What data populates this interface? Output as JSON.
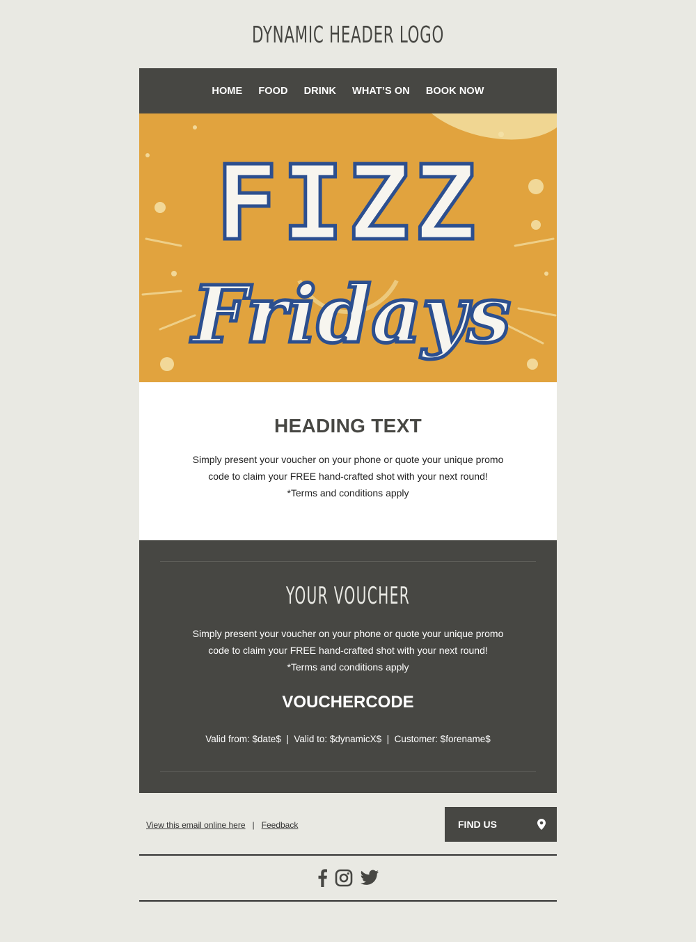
{
  "header": {
    "logo_text": "DYNAMIC HEADER LOGO"
  },
  "nav": {
    "items": [
      {
        "label": "HOME"
      },
      {
        "label": "FOOD"
      },
      {
        "label": "DRINK"
      },
      {
        "label": "WHAT’S ON"
      },
      {
        "label": "BOOK NOW"
      }
    ]
  },
  "hero": {
    "line1": "FIZZ",
    "line2": "Fridays",
    "bg_color": "#e1a33e"
  },
  "intro": {
    "heading": "HEADING TEXT",
    "line1": "Simply present your voucher on your phone or quote your unique promo",
    "line2": "code to claim your FREE hand-crafted shot with your next round!",
    "line3": "*Terms and conditions apply"
  },
  "voucher": {
    "title": "YOUR VOUCHER",
    "line1": "Simply present your voucher on your phone or quote your unique promo",
    "line2": "code to claim your FREE hand-crafted shot with your next round!",
    "line3": "*Terms and conditions apply",
    "code": "VOUCHERCODE",
    "validity": "Valid from: $date$  |  Valid to: $dynamicX$  |  Customer: $forename$"
  },
  "footer": {
    "view_online": "View this email online here",
    "separator": "|",
    "feedback": "Feedback",
    "find_us": "FIND US",
    "icons": [
      "facebook-icon",
      "instagram-icon",
      "twitter-icon",
      "location-pin-icon"
    ]
  },
  "colors": {
    "dark": "#474743",
    "background": "#e9e9e3",
    "accent": "#e1a33e"
  }
}
